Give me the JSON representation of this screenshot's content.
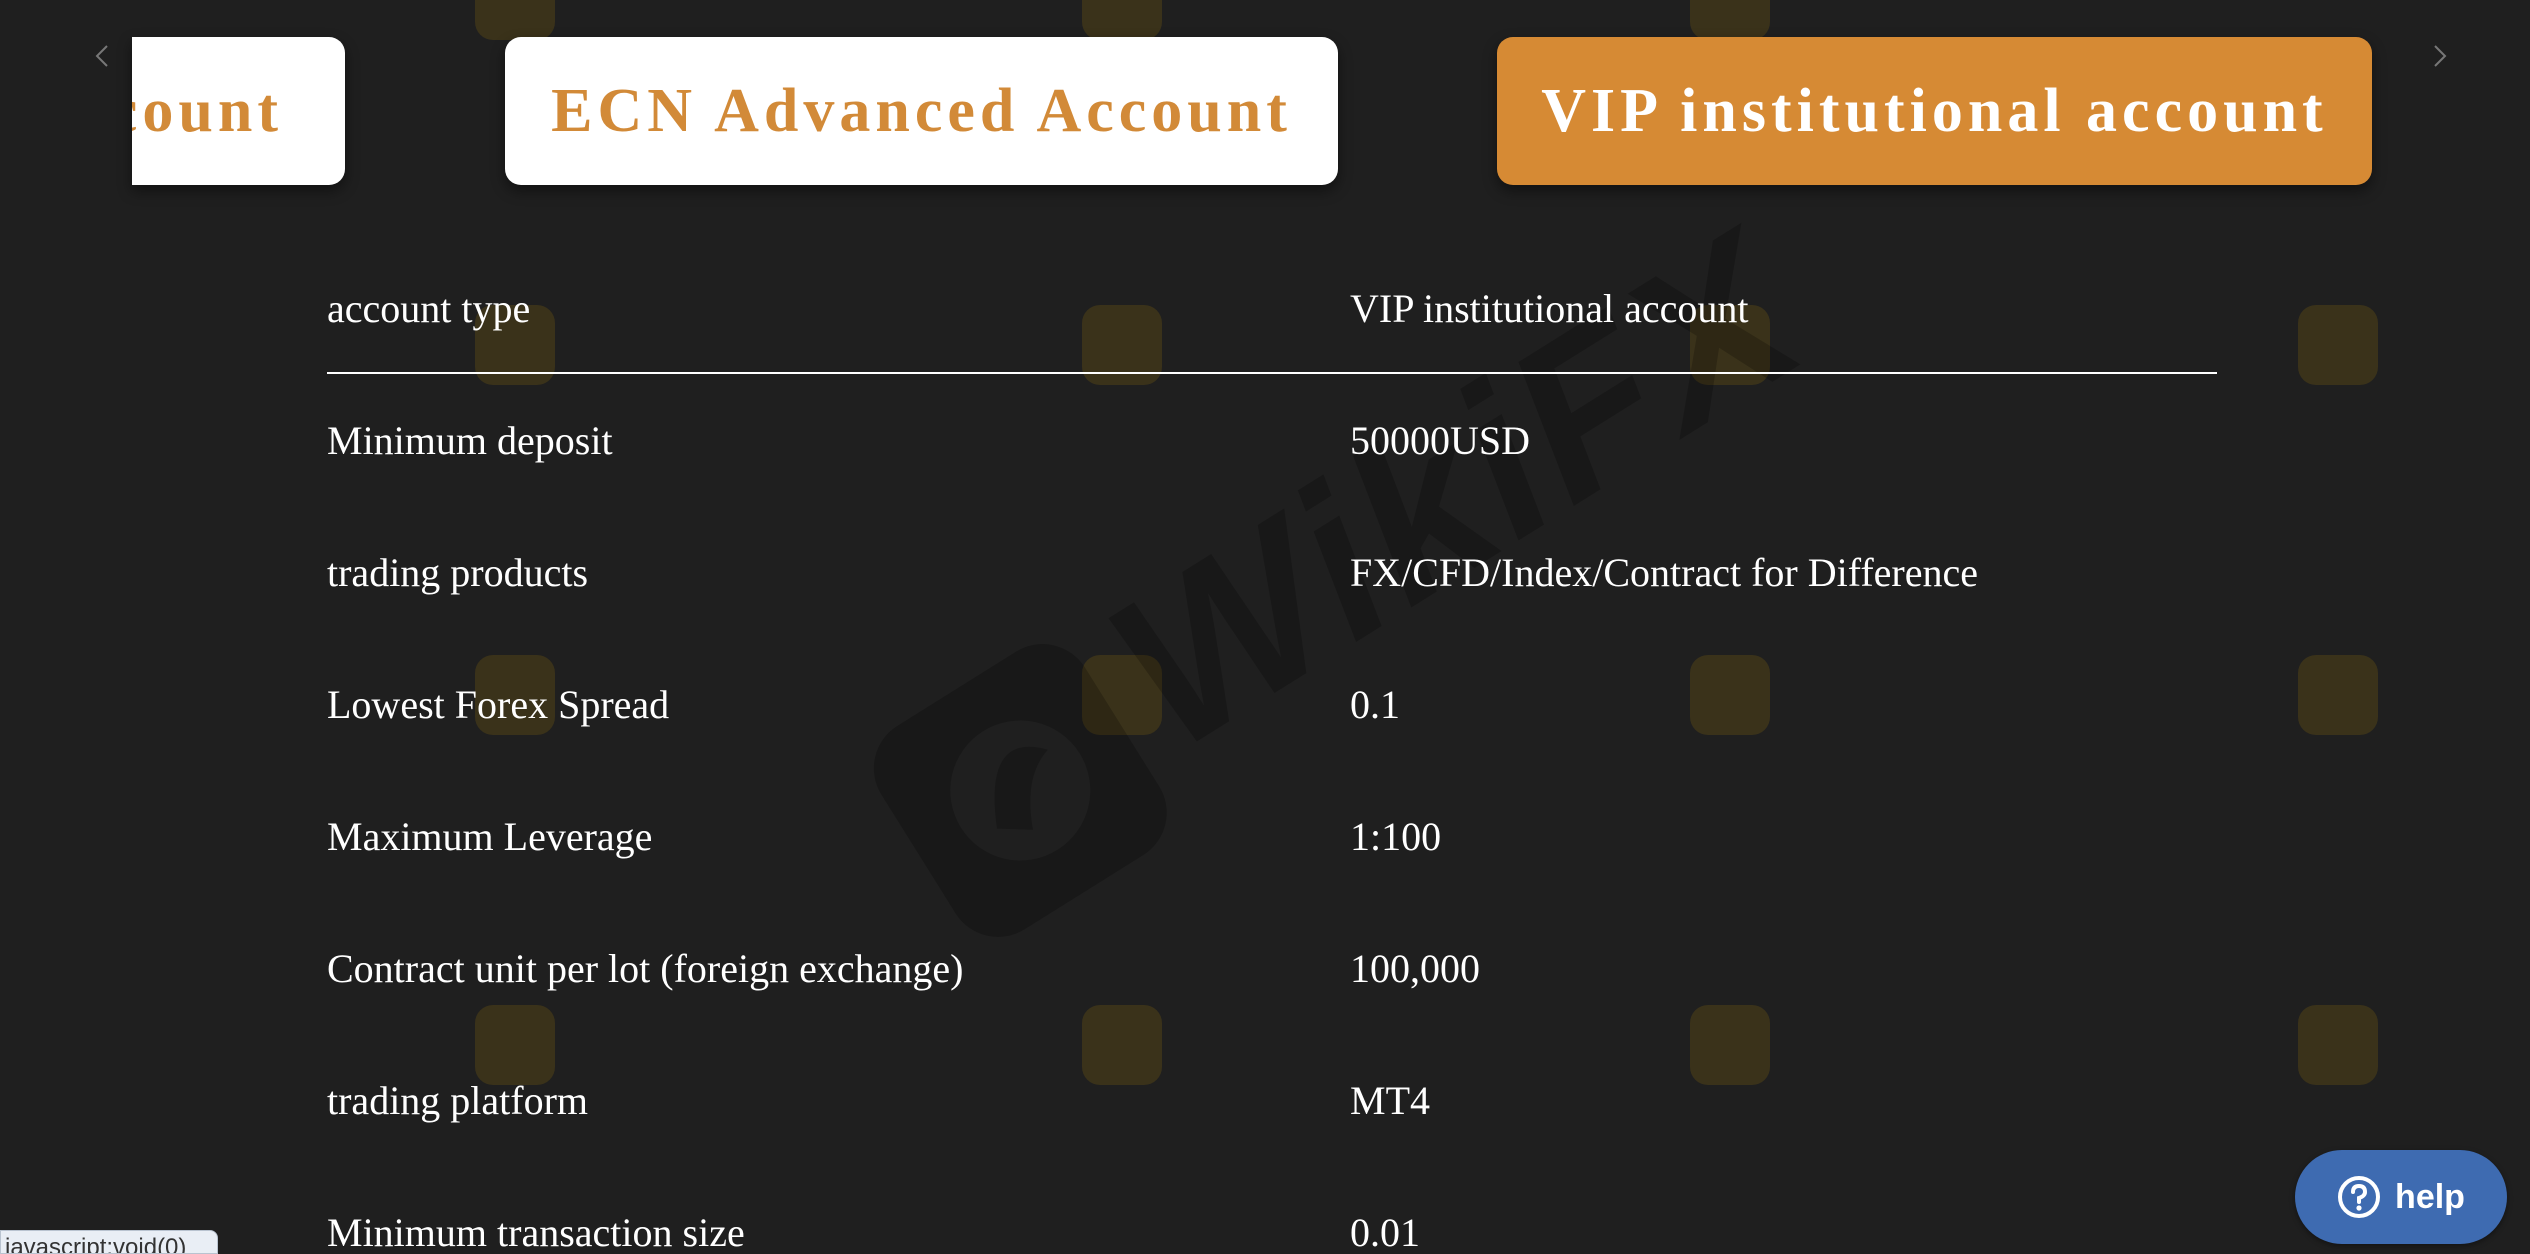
{
  "carousel": {
    "tabs": [
      {
        "label": "count",
        "state": "inactive"
      },
      {
        "label": "ECN Advanced Account",
        "state": "inactive"
      },
      {
        "label": "VIP institutional account",
        "state": "active"
      }
    ],
    "icons": {
      "prev": "chevron-left-icon",
      "next": "chevron-right-icon"
    }
  },
  "watermark": {
    "text": "WikiFX"
  },
  "table": {
    "rows": [
      {
        "label": "account type",
        "value": "VIP institutional account"
      },
      {
        "label": "Minimum deposit",
        "value": "50000USD"
      },
      {
        "label": "trading products",
        "value": "FX/CFD/Index/Contract for Difference"
      },
      {
        "label": "Lowest Forex Spread",
        "value": "0.1"
      },
      {
        "label": "Maximum Leverage",
        "value": "1:100"
      },
      {
        "label": "Contract unit per lot (foreign exchange)",
        "value": "100,000"
      },
      {
        "label": "trading platform",
        "value": "MT4"
      },
      {
        "label": "Minimum transaction size",
        "value": "0.01"
      }
    ]
  },
  "help": {
    "label": "help",
    "icon": "question-circle-icon"
  },
  "status_bar": {
    "url": "javascript:void(0)"
  },
  "colors": {
    "background": "#1f1f1f",
    "accent": "#d68a34",
    "tab_text": "#d28a38",
    "help_button": "#3e6bb1"
  }
}
